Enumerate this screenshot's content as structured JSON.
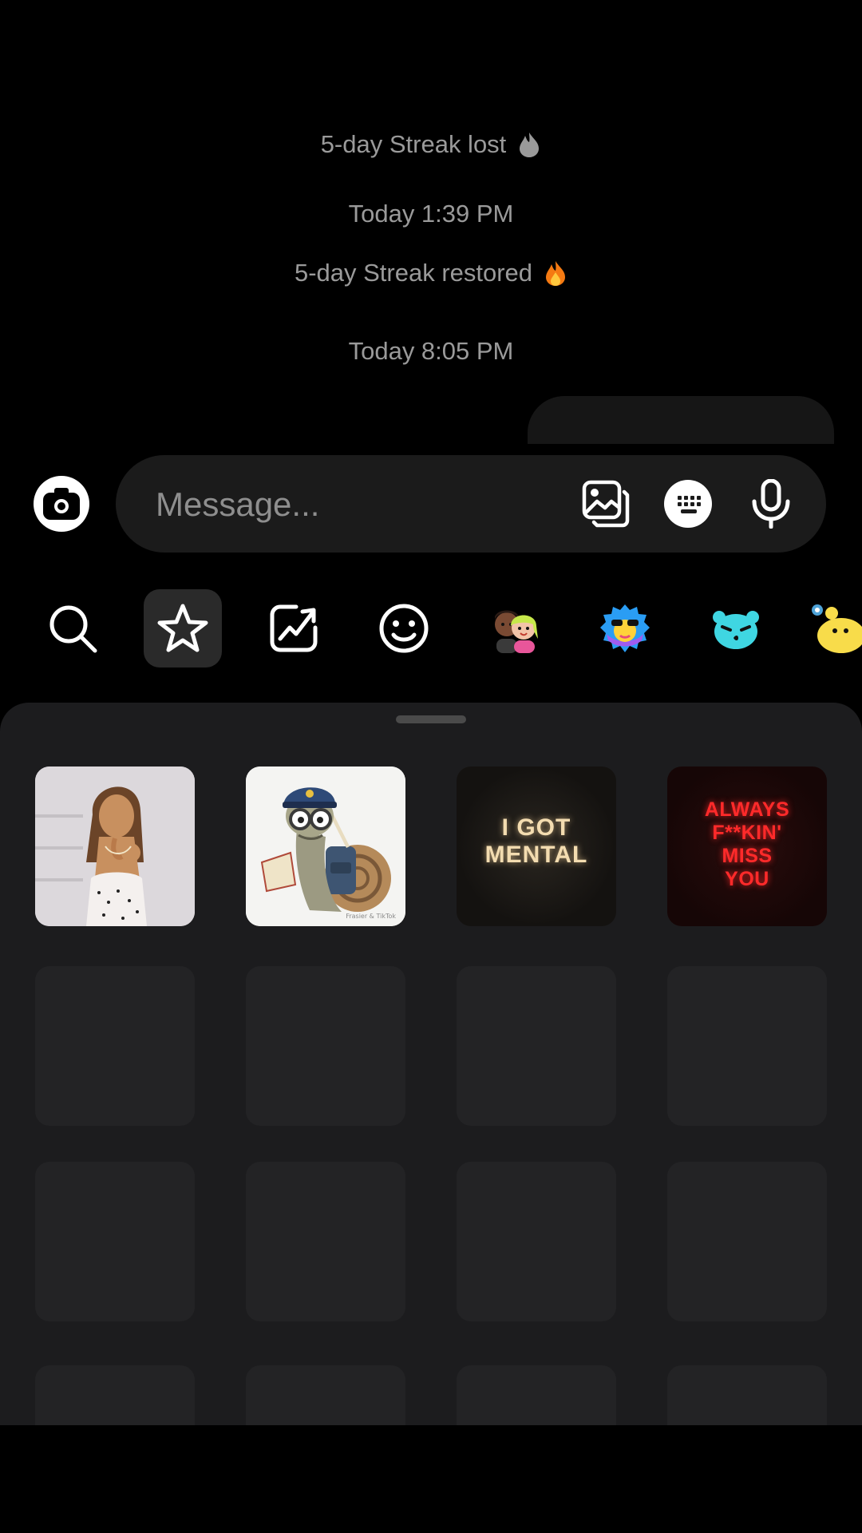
{
  "chat": {
    "streak_lost": "5-day Streak lost",
    "time_1": "Today 1:39 PM",
    "streak_restored": "5-day Streak restored",
    "time_2": "Today 8:05 PM"
  },
  "composer": {
    "placeholder": "Message..."
  },
  "tabs": [
    {
      "icon": "search-icon"
    },
    {
      "icon": "star-icon",
      "selected": true
    },
    {
      "icon": "trending-icon"
    },
    {
      "icon": "emoji-icon"
    },
    {
      "icon": "avatar-couple-icon"
    },
    {
      "icon": "blue-sticker-pack-icon"
    },
    {
      "icon": "cyan-sticker-pack-icon"
    },
    {
      "icon": "yellow-sticker-pack-icon"
    }
  ],
  "stickers": [
    {
      "kind": "photo",
      "alt": "woman photo sticker"
    },
    {
      "kind": "illustration",
      "alt": "snail mail carrier sticker",
      "watermark": "Frasier & TikTok"
    },
    {
      "kind": "text",
      "lines": [
        "I GOT",
        "MENTAL"
      ]
    },
    {
      "kind": "text",
      "lines": [
        "ALWAYS",
        "F**KIN'",
        "MISS",
        "YOU"
      ]
    }
  ],
  "colors": {
    "background": "#000000",
    "sheet": "#1c1c1e",
    "composer": "#1b1b1b",
    "secondary_text": "#9a9a9a",
    "neon_red": "#ff2a2a",
    "gold_text": "#f3dcb0"
  }
}
